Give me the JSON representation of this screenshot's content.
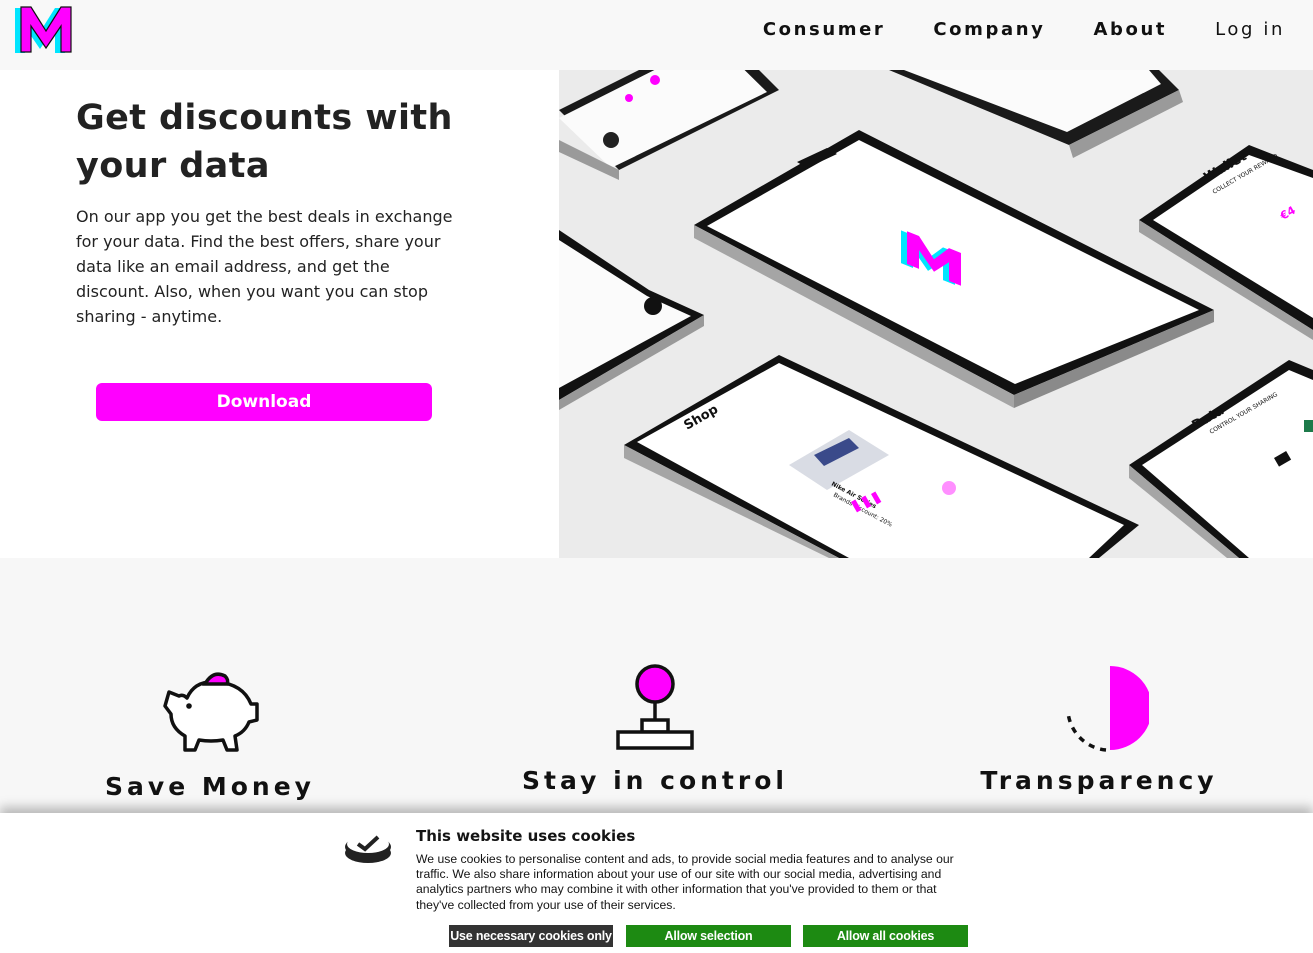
{
  "brand": {
    "logo_letter": "M",
    "accent_color": "#ff00ff",
    "secondary_color": "#00e5ff"
  },
  "nav": {
    "links": [
      {
        "label": "Consumer"
      },
      {
        "label": "Company"
      },
      {
        "label": "About"
      },
      {
        "label": "Log in"
      }
    ]
  },
  "hero": {
    "title": "Get discounts with your data",
    "text": "On our app you get the best deals in exchange for your data. Find the best offers, share your data like an email address, and get the discount. Also, when you want you can stop sharing - anytime.",
    "download_label": "Download",
    "phones": {
      "shop_title": "Shop",
      "shop_product": "Nike Air Series",
      "shop_discount": "Brands discount: 20%",
      "wallet_title": "Wallet",
      "wallet_subtitle": "COLLECT YOUR REWARD",
      "data_title": "Data",
      "data_subtitle": "CONTROL YOUR SHARING"
    }
  },
  "features": [
    {
      "title": "Save Money",
      "icon": "piggy-bank-icon"
    },
    {
      "title": "Stay in control",
      "icon": "joystick-icon"
    },
    {
      "title": "Transparency",
      "icon": "half-circle-icon"
    }
  ],
  "cookie": {
    "title": "This website uses cookies",
    "text": "We use cookies to personalise content and ads, to provide social media features and to analyse our traffic. We also share information about your use of our site with our social media, advertising and analytics partners who may combine it with other information that you've provided to them or that they've collected from your use of their services.",
    "buttons": {
      "necessary": "Use necessary cookies only",
      "selection": "Allow selection",
      "all": "Allow all cookies"
    },
    "colors": {
      "dark_button": "#333333",
      "green_button": "#1d8a12"
    }
  }
}
